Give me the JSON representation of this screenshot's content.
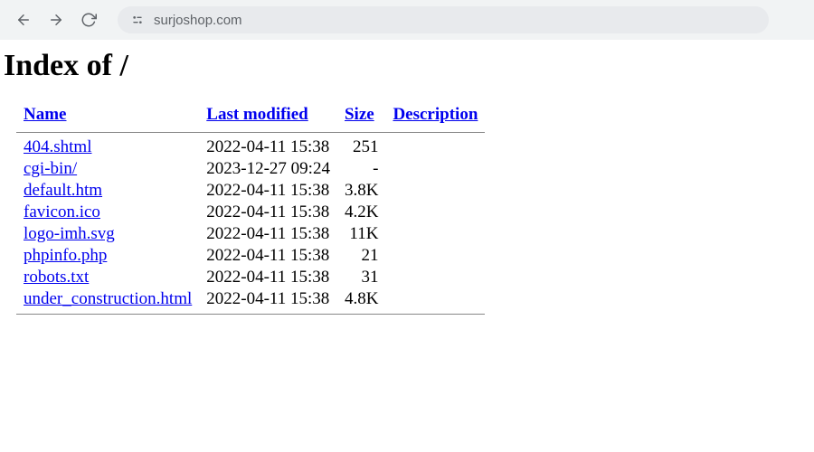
{
  "browser": {
    "url": "surjoshop.com"
  },
  "page": {
    "title": "Index of /"
  },
  "headers": {
    "name": "Name",
    "modified": "Last modified",
    "size": "Size",
    "description": "Description"
  },
  "files": [
    {
      "name": "404.shtml",
      "modified": "2022-04-11 15:38",
      "size": "251"
    },
    {
      "name": "cgi-bin/",
      "modified": "2023-12-27 09:24",
      "size": "-"
    },
    {
      "name": "default.htm",
      "modified": "2022-04-11 15:38",
      "size": "3.8K"
    },
    {
      "name": "favicon.ico",
      "modified": "2022-04-11 15:38",
      "size": "4.2K"
    },
    {
      "name": "logo-imh.svg",
      "modified": "2022-04-11 15:38",
      "size": "11K"
    },
    {
      "name": "phpinfo.php",
      "modified": "2022-04-11 15:38",
      "size": "21"
    },
    {
      "name": "robots.txt",
      "modified": "2022-04-11 15:38",
      "size": "31"
    },
    {
      "name": "under_construction.html",
      "modified": "2022-04-11 15:38",
      "size": "4.8K"
    }
  ]
}
